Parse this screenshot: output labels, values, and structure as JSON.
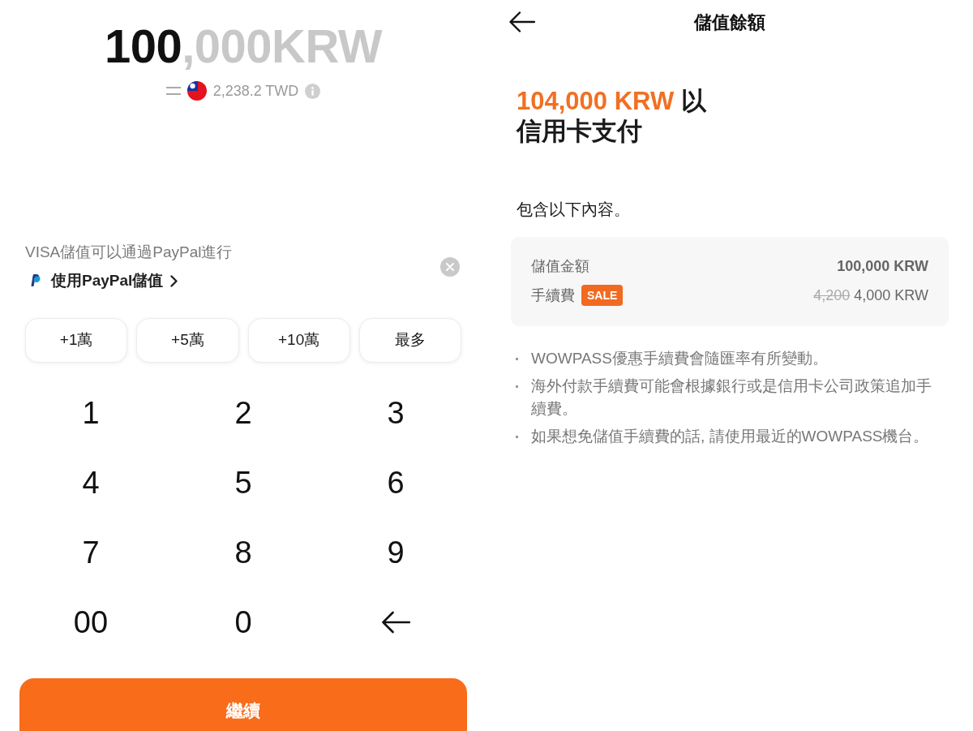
{
  "topup_screen": {
    "amount": {
      "entered": "100",
      "remaining": ",000KRW"
    },
    "conversion": {
      "value": "2,238.2 TWD"
    },
    "paypal_banner": {
      "message": "VISA儲值可以通過PayPal進行",
      "link": "使用PayPal儲值"
    },
    "quick_amounts": [
      "+1萬",
      "+5萬",
      "+10萬",
      "最多"
    ],
    "keypad": [
      {
        "kind": "digit",
        "label": "1"
      },
      {
        "kind": "digit",
        "label": "2"
      },
      {
        "kind": "digit",
        "label": "3"
      },
      {
        "kind": "digit",
        "label": "4"
      },
      {
        "kind": "digit",
        "label": "5"
      },
      {
        "kind": "digit",
        "label": "6"
      },
      {
        "kind": "digit",
        "label": "7"
      },
      {
        "kind": "digit",
        "label": "8"
      },
      {
        "kind": "digit",
        "label": "9"
      },
      {
        "kind": "digit",
        "label": "00"
      },
      {
        "kind": "digit",
        "label": "0"
      },
      {
        "kind": "backspace"
      }
    ],
    "continue_button": "繼續"
  },
  "payment_screen": {
    "title": "儲值餘額",
    "headline": {
      "amount": "104,000 KRW",
      "text": "以信用卡支付"
    },
    "includes_label": "包含以下內容。",
    "summary": [
      {
        "kind": "amount",
        "label": "儲值金額",
        "value": "100,000 KRW"
      },
      {
        "kind": "fee",
        "label": "手續費",
        "badge": "SALE",
        "original_value": "4,200",
        "value": "4,000 KRW"
      }
    ],
    "notes": [
      "WOWPASS優惠手續費會隨匯率有所變動。",
      "海外付款手續費可能會根據銀行或是信用卡公司政策追加手續費。",
      "如果想免儲值手續費的話, 請使用最近的WOWPASS機台。"
    ]
  }
}
